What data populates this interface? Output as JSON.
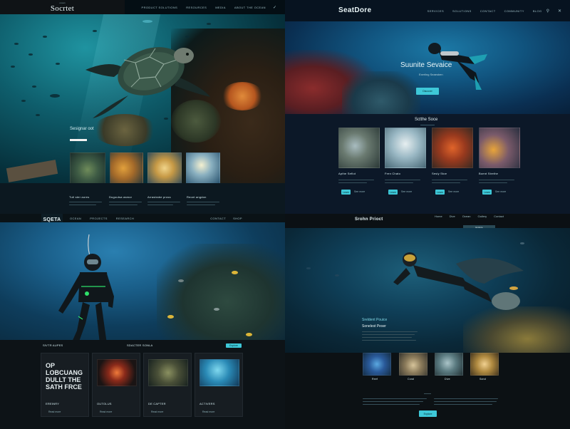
{
  "q1": {
    "logo": "Socrtet",
    "nav": [
      "Product solutions",
      "Resources",
      "Media",
      "About the ocean"
    ],
    "nav_small": "Support",
    "section_title": "Sesignar oot",
    "columns": [
      "Tutl ster aores",
      "Dugoutsa asmor",
      "Arrastrabe pross",
      "Reont angdon"
    ]
  },
  "q2": {
    "logo": "SeatDore",
    "nav": [
      "Services",
      "Solutions",
      "Contact",
      "Community",
      "Blog"
    ],
    "hero_title": "Suunite Sevaice",
    "hero_sub": "Exerling Seaesben",
    "hero_button": "Discover",
    "section_title": "Sctthe Soce",
    "cards": [
      {
        "label": "Apthe Seflot",
        "button": "Learn",
        "link": "See more"
      },
      {
        "label": "Fren Chato",
        "button": "Learn",
        "link": "See more"
      },
      {
        "label": "Sesly Stoe",
        "button": "Learn",
        "link": "See more"
      },
      {
        "label": "Boent Strethe",
        "button": "Learn",
        "link": "See more"
      }
    ]
  },
  "q3": {
    "logo": "SQETA",
    "nav": [
      "Ocean",
      "Projects",
      "Research",
      "Contact",
      "Shop"
    ],
    "band_left": "Sivtr aupes",
    "band_mid": "Sdacter Sonla",
    "band_button": "Explore",
    "headline": [
      "OP",
      "LOBCUANG",
      "DULLT THE",
      "SATH FRCE"
    ],
    "cards": [
      {
        "label": "Ereinry",
        "link": "Read more"
      },
      {
        "label": "Outolus",
        "link": "Read more"
      },
      {
        "label": "De Capter",
        "link": "Read more"
      },
      {
        "label": "Activers",
        "link": "Read more"
      }
    ]
  },
  "q4": {
    "logo": "Srohn Prioct",
    "nav": [
      "Home",
      "Dive",
      "Ocean",
      "Gallery",
      "Contact"
    ],
    "tab_active": "Explore",
    "hero_kicker": "Sreldent Pouice",
    "hero_title": "Sonelest Peser",
    "thumb_labels": [
      "Reef",
      "Coral",
      "Dive",
      "Sand"
    ],
    "button": "Explore"
  }
}
